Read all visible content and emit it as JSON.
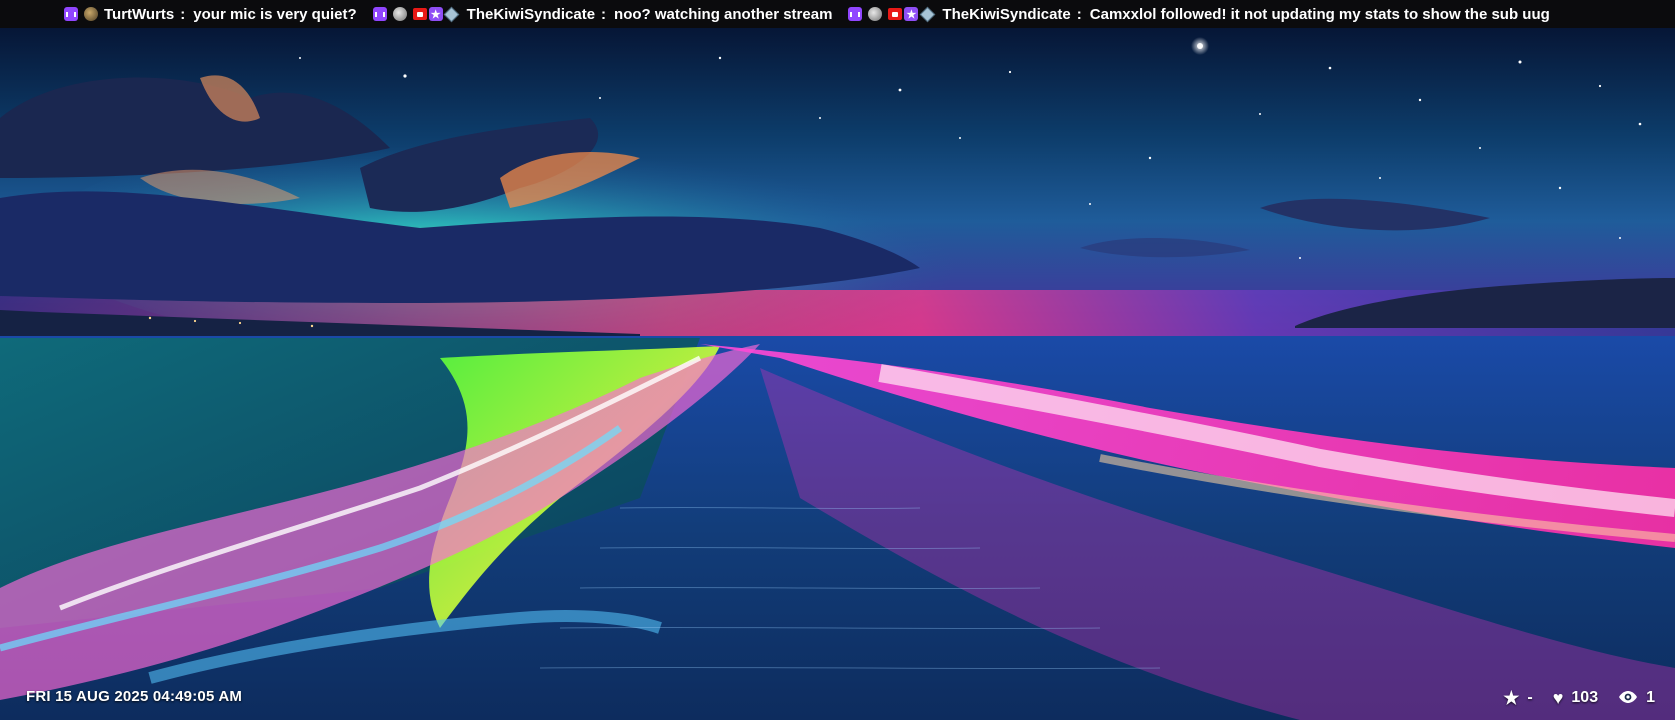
{
  "chat": {
    "messages": [
      {
        "user": "TurtWurts",
        "separator": ":",
        "text": "your mic is very quiet?",
        "icons": [
          "twitch-icon",
          "avatar-icon"
        ]
      },
      {
        "user": "TheKiwiSyndicate",
        "separator": ":",
        "text": "noo? watching another stream",
        "icons": [
          "twitch-icon",
          "avatar-icon",
          "broadcaster-badge-icon",
          "star-badge-icon",
          "diamond-badge-icon"
        ]
      },
      {
        "user": "TheKiwiSyndicate",
        "separator": ":",
        "text": "Camxxlol followed!  it not updating my stats to show the sub uug",
        "icons": [
          "twitch-icon",
          "avatar-icon",
          "broadcaster-badge-icon",
          "star-badge-icon",
          "diamond-badge-icon"
        ]
      }
    ]
  },
  "overlay": {
    "datetime": "FRI 15 AUG 2025 04:49:05 AM",
    "stats": {
      "star_icon": "star-icon",
      "subs": "-",
      "heart_icon": "heart-icon",
      "likes": "103",
      "eye_icon": "eye-icon",
      "viewers": "1"
    }
  },
  "colors": {
    "ticker_bg": "#0b0b0d",
    "twitch": "#9146ff",
    "broadcaster": "#e91916"
  }
}
